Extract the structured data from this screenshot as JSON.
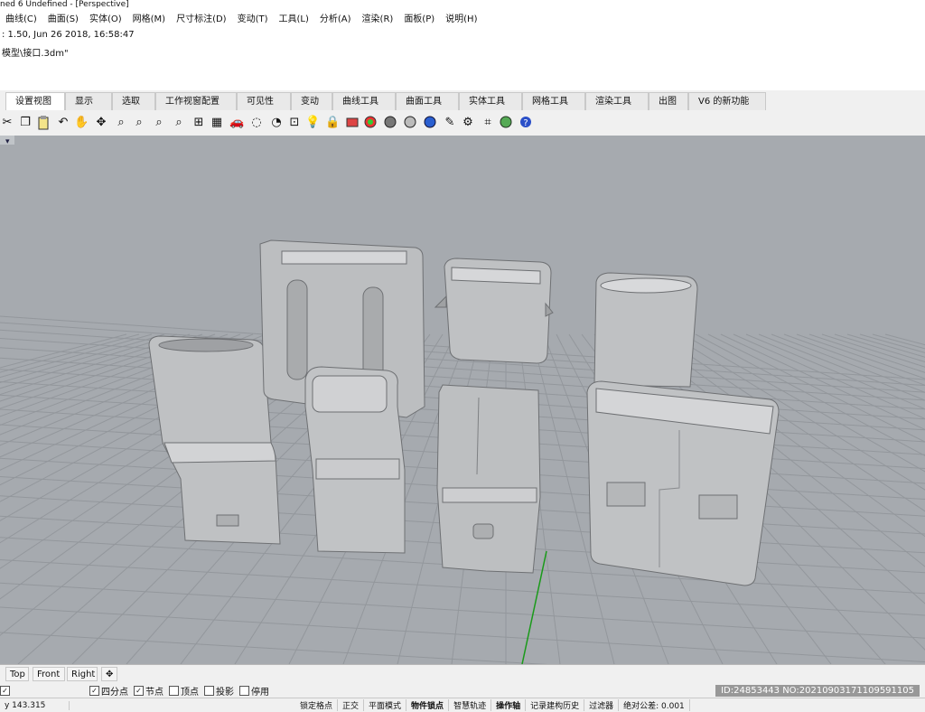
{
  "window": {
    "title": "ned 6 Undefined - [Perspective]"
  },
  "menu": [
    "曲线(C)",
    "曲面(S)",
    "实体(O)",
    "网格(M)",
    "尺寸标注(D)",
    "变动(T)",
    "工具(L)",
    "分析(A)",
    "渲染(R)",
    "面板(P)",
    "说明(H)"
  ],
  "command_history": [
    ": 1.50, Jun 26 2018, 16:58:47",
    "模型\\接口.3dm\""
  ],
  "toolbar_tabs": [
    "设置视图",
    "显示",
    "选取",
    "工作视窗配置",
    "可见性",
    "变动",
    "曲线工具",
    "曲面工具",
    "实体工具",
    "网格工具",
    "渲染工具",
    "出图",
    "V6 的新功能"
  ],
  "icons": [
    "cut-icon",
    "copy-icon",
    "paste-icon",
    "undo-icon",
    "pan-icon",
    "rotate-icon",
    "zoom-icon",
    "zoom-window-icon",
    "zoom-extents-icon",
    "zoom-selected-icon",
    "viewport-layout-icon",
    "car-icon",
    "grid-icon",
    "snap-icon",
    "layer-icon",
    "light-icon",
    "lock-icon",
    "properties-icon",
    "color-wheel-icon",
    "render-sphere-icon",
    "material-sphere-icon",
    "render-icon",
    "globe-icon",
    "paint-icon",
    "gear-icon",
    "transform-icon",
    "plugin-icon",
    "help-icon"
  ],
  "colors": {
    "viewport_bg": "#a6aaaf",
    "grid_line": "#8f9398",
    "axis_green": "#1a9a1a",
    "axis_red": "#b04040",
    "model": "#bfc1c3"
  },
  "view_tabs": [
    "Top",
    "Front",
    "Right"
  ],
  "osnaps": [
    {
      "label": "",
      "checked": true
    },
    {
      "label": "节点",
      "checked": true
    },
    {
      "label": "顶点",
      "checked": false
    },
    {
      "label": "投影",
      "checked": false
    },
    {
      "label": "停用",
      "checked": false
    }
  ],
  "osnap_partial": [
    "四分点"
  ],
  "status": {
    "coord": "y 143.315",
    "items": [
      "锁定格点",
      "正交",
      "平面模式",
      "物件锁点",
      "智慧轨迹",
      "操作轴",
      "记录建构历史",
      "过滤器",
      "绝对公差: 0.001"
    ],
    "bold": [
      "物件锁点",
      "操作轴"
    ]
  },
  "watermark": "ID:24853443 NO:20210903171109591105"
}
